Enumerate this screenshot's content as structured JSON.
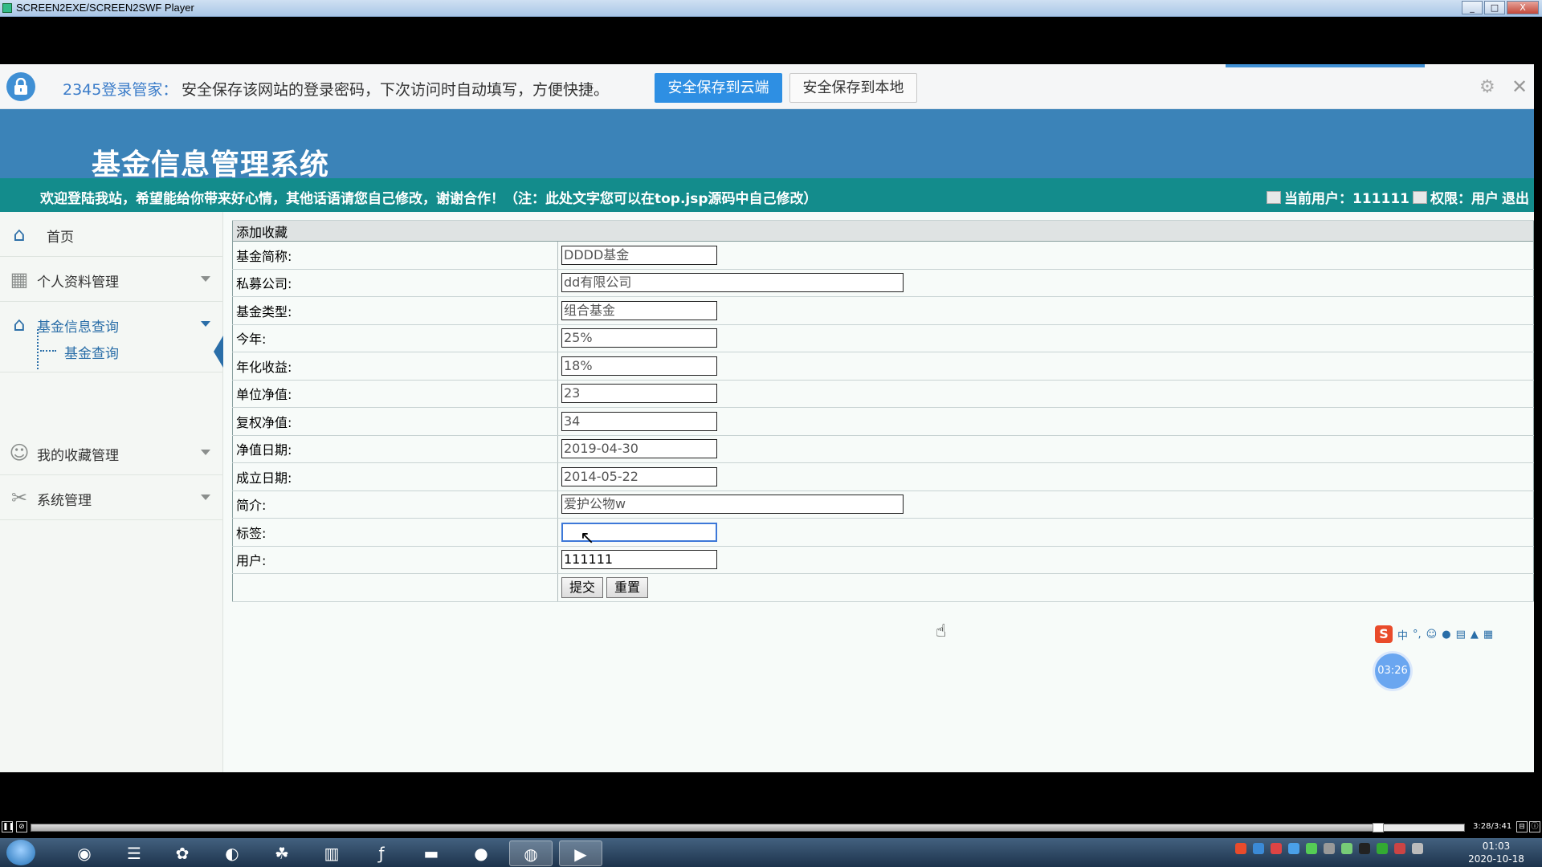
{
  "window": {
    "title": "SCREEN2EXE/SCREEN2SWF Player",
    "buttons": [
      "_",
      "□",
      "X"
    ]
  },
  "password_bar": {
    "brand": "2345登录管家：",
    "message": "安全保存该网站的登录密码，下次访问时自动填写，方便快捷。",
    "save_cloud": "安全保存到云端",
    "save_local": "安全保存到本地",
    "icons": [
      "lock-icon",
      "gear-icon",
      "close-icon"
    ],
    "colors": {
      "accent": "#2e8fe3"
    }
  },
  "site": {
    "title": "基金信息管理系统",
    "welcome": "欢迎登陆我站，希望能给你带来好心情，其他话语请您自己修改，谢谢合作！（注：此处文字您可以在top.jsp源码中自己修改）",
    "current_user": "当前用户：111111",
    "permission": "权限：用户",
    "logout": "退出",
    "colors": {
      "header": "#3b83b8",
      "marquee": "#138c8c"
    }
  },
  "sidebar": {
    "items": [
      {
        "label": "首页",
        "icon": "home-icon"
      },
      {
        "label": "个人资料管理",
        "icon": "grid-icon"
      },
      {
        "label": "基金信息查询",
        "icon": "home-icon"
      },
      {
        "label": "我的收藏管理",
        "icon": "users-icon"
      },
      {
        "label": "系统管理",
        "icon": "tools-icon"
      }
    ],
    "sub_item": "基金查询"
  },
  "form": {
    "caption": "添加收藏",
    "rows": [
      {
        "label": "基金简称:",
        "value": "DDDD基金"
      },
      {
        "label": "私募公司:",
        "value": "dd有限公司"
      },
      {
        "label": "基金类型:",
        "value": "组合基金"
      },
      {
        "label": "今年:",
        "value": "25%"
      },
      {
        "label": "年化收益:",
        "value": "18%"
      },
      {
        "label": "单位净值:",
        "value": "23"
      },
      {
        "label": "复权净值:",
        "value": "34"
      },
      {
        "label": "净值日期:",
        "value": "2019-04-30"
      },
      {
        "label": "成立日期:",
        "value": "2014-05-22"
      },
      {
        "label": "简介:",
        "value": "爱护公物w"
      },
      {
        "label": "标签:",
        "value": ""
      },
      {
        "label": "用户:",
        "value": "111111"
      }
    ],
    "submit": "提交",
    "reset": "重置"
  },
  "ime": {
    "logo": "S",
    "mode": "中",
    "punct": "°,",
    "timer": "03:26"
  },
  "player": {
    "time": "3:28/3:41",
    "progress": 0.94
  },
  "taskbar": {
    "apps": [
      "chrome-icon",
      "eclipse-icon",
      "baidu-netdisk-icon",
      "browser-icon",
      "app-icon",
      "notepad-icon",
      "flash-icon",
      "explorer-icon",
      "qq-icon",
      "wechat-icon",
      "player-icon"
    ],
    "clock_time": "01:03",
    "clock_date": "2020-10-18"
  }
}
